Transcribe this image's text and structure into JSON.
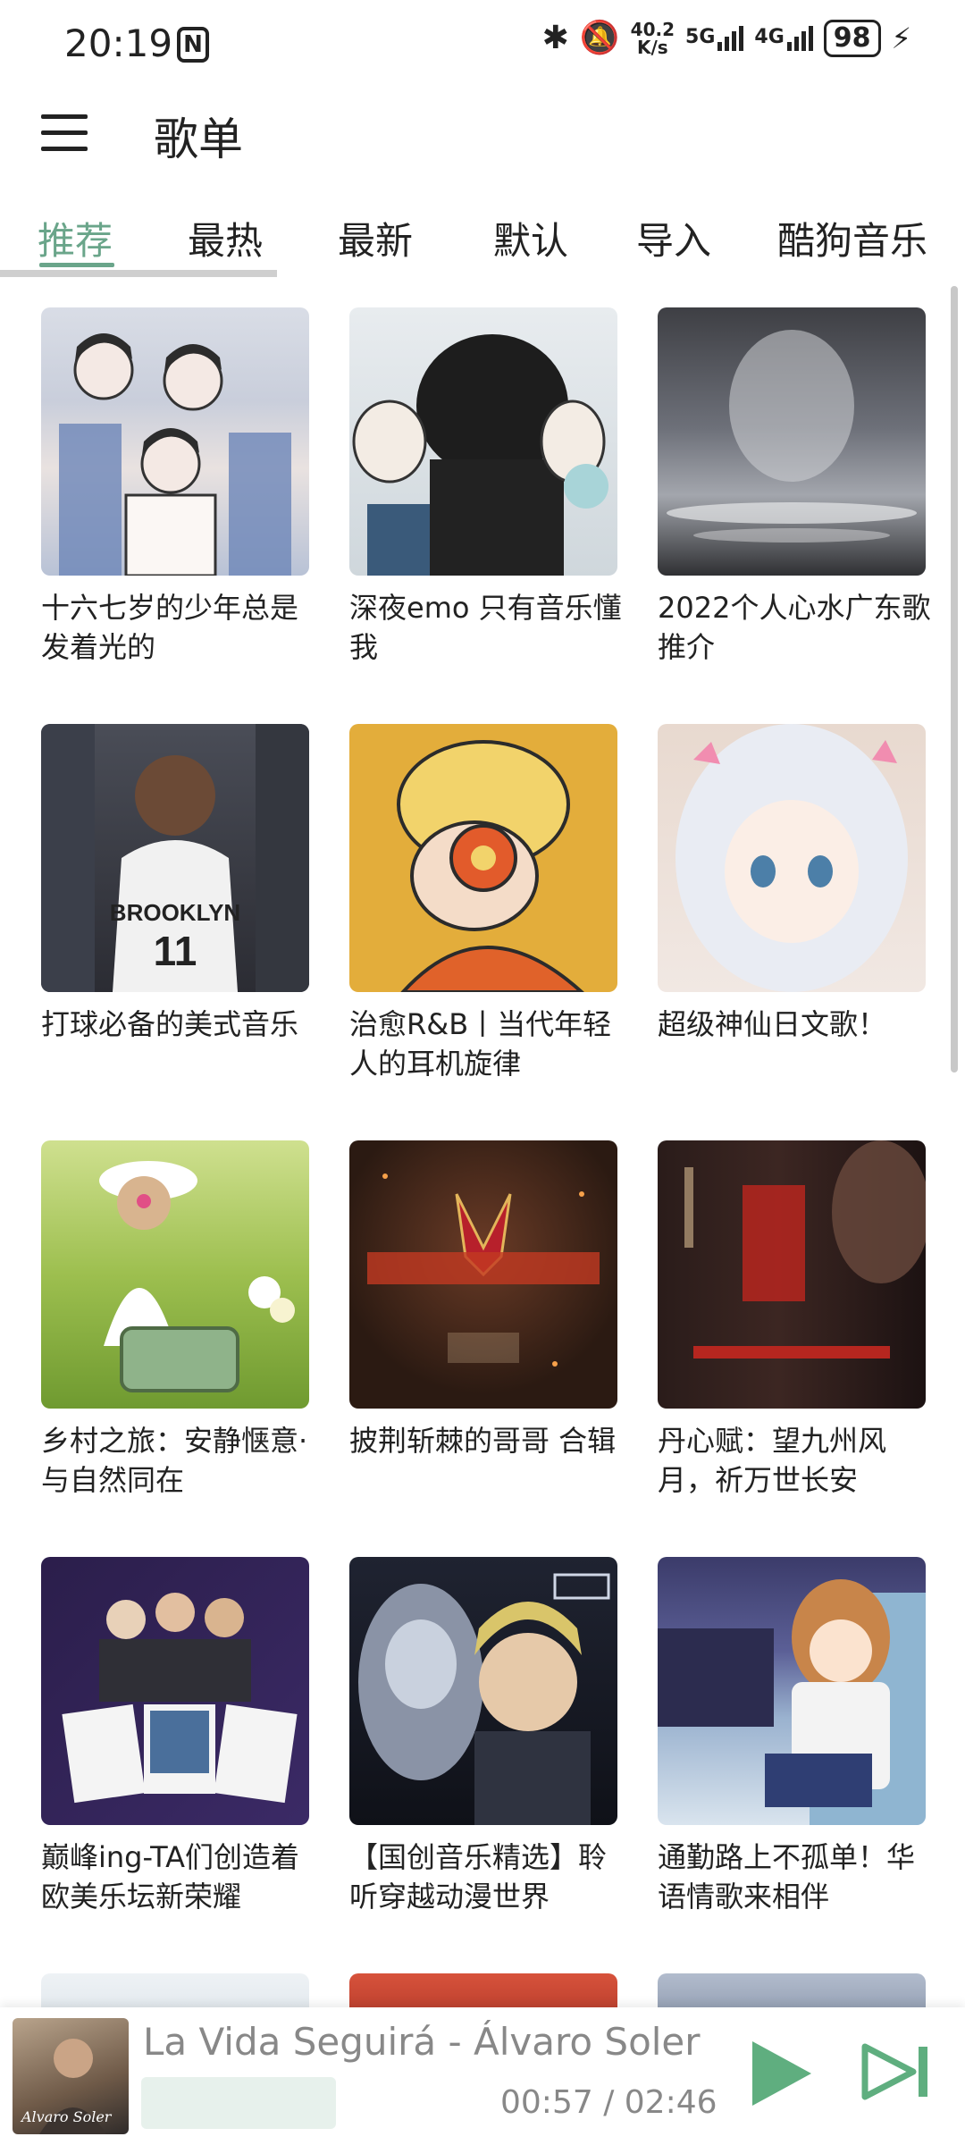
{
  "status_bar": {
    "time": "20:19",
    "nfc_label": "N",
    "speed_top": "40.2",
    "speed_bottom": "K/s",
    "net1": "5G",
    "net2": "4G",
    "battery": "98"
  },
  "header": {
    "title": "歌单"
  },
  "tabs": [
    {
      "label": "推荐",
      "active": true
    },
    {
      "label": "最热",
      "active": false
    },
    {
      "label": "最新",
      "active": false
    },
    {
      "label": "默认",
      "active": false
    },
    {
      "label": "导入",
      "active": false
    },
    {
      "label": "酷狗音乐",
      "active": false
    }
  ],
  "playlists": [
    {
      "title": "十六七岁的少年总是发着光的",
      "cover": "illustration-boys"
    },
    {
      "title": "深夜emo 只有音乐懂我",
      "cover": "anime-crowd"
    },
    {
      "title": "2022个人心水广东歌推介",
      "cover": "portrait-mist"
    },
    {
      "title": "打球必备的美式音乐",
      "cover": "basketball-player"
    },
    {
      "title": "治愈R&B丨当代年轻人的耳机旋律",
      "cover": "headphones-kid"
    },
    {
      "title": "超级神仙日文歌！",
      "cover": "anime-girl"
    },
    {
      "title": "乡村之旅：安静惬意·与自然同在",
      "cover": "girl-in-field"
    },
    {
      "title": "披荆斩棘的哥哥 合辑",
      "cover": "show-logo"
    },
    {
      "title": "丹心赋：望九州风月，祈万世长安",
      "cover": "chinese-poster"
    },
    {
      "title": "巅峰ing-TA们创造着欧美乐坛新荣耀",
      "cover": "pop-stars"
    },
    {
      "title": "【国创音乐精选】聆听穿越动漫世界",
      "cover": "cg-anime"
    },
    {
      "title": "通勤路上不孤单！华语情歌来相伴",
      "cover": "train-girl"
    }
  ],
  "player": {
    "song": "La Vida Seguirá - Álvaro Soler",
    "time": "00:57 / 02:46",
    "accent": "#5fae7f"
  },
  "colors": {
    "accent": "#6aa58a"
  }
}
